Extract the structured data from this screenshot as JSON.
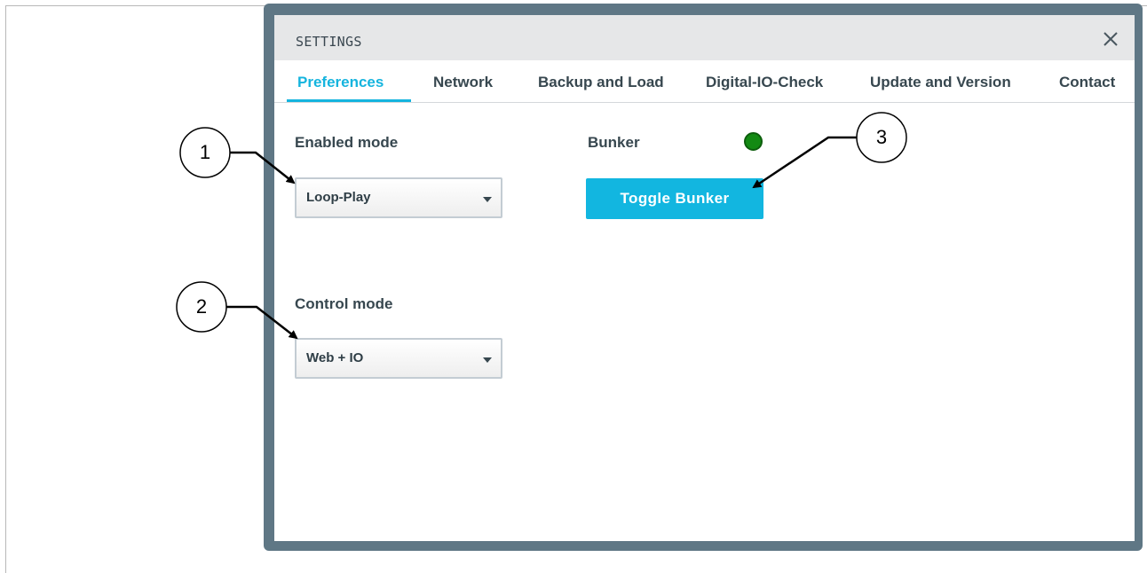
{
  "dialog": {
    "title": "SETTINGS",
    "close_icon": "close-icon"
  },
  "tabs": [
    {
      "label": "Preferences",
      "active": true
    },
    {
      "label": "Network",
      "active": false
    },
    {
      "label": "Backup and Load",
      "active": false
    },
    {
      "label": "Digital-IO-Check",
      "active": false
    },
    {
      "label": "Update and Version",
      "active": false
    },
    {
      "label": "Contact",
      "active": false
    }
  ],
  "preferences": {
    "enabled_mode": {
      "label": "Enabled mode",
      "value": "Loop-Play"
    },
    "control_mode": {
      "label": "Control mode",
      "value": "Web + IO"
    },
    "bunker": {
      "label": "Bunker",
      "status_color": "#138a13",
      "button_label": "Toggle Bunker"
    }
  },
  "callouts": [
    "1",
    "2",
    "3"
  ],
  "colors": {
    "accent": "#15b4de",
    "dialog_border": "#5f7785",
    "text": "#37474f"
  }
}
